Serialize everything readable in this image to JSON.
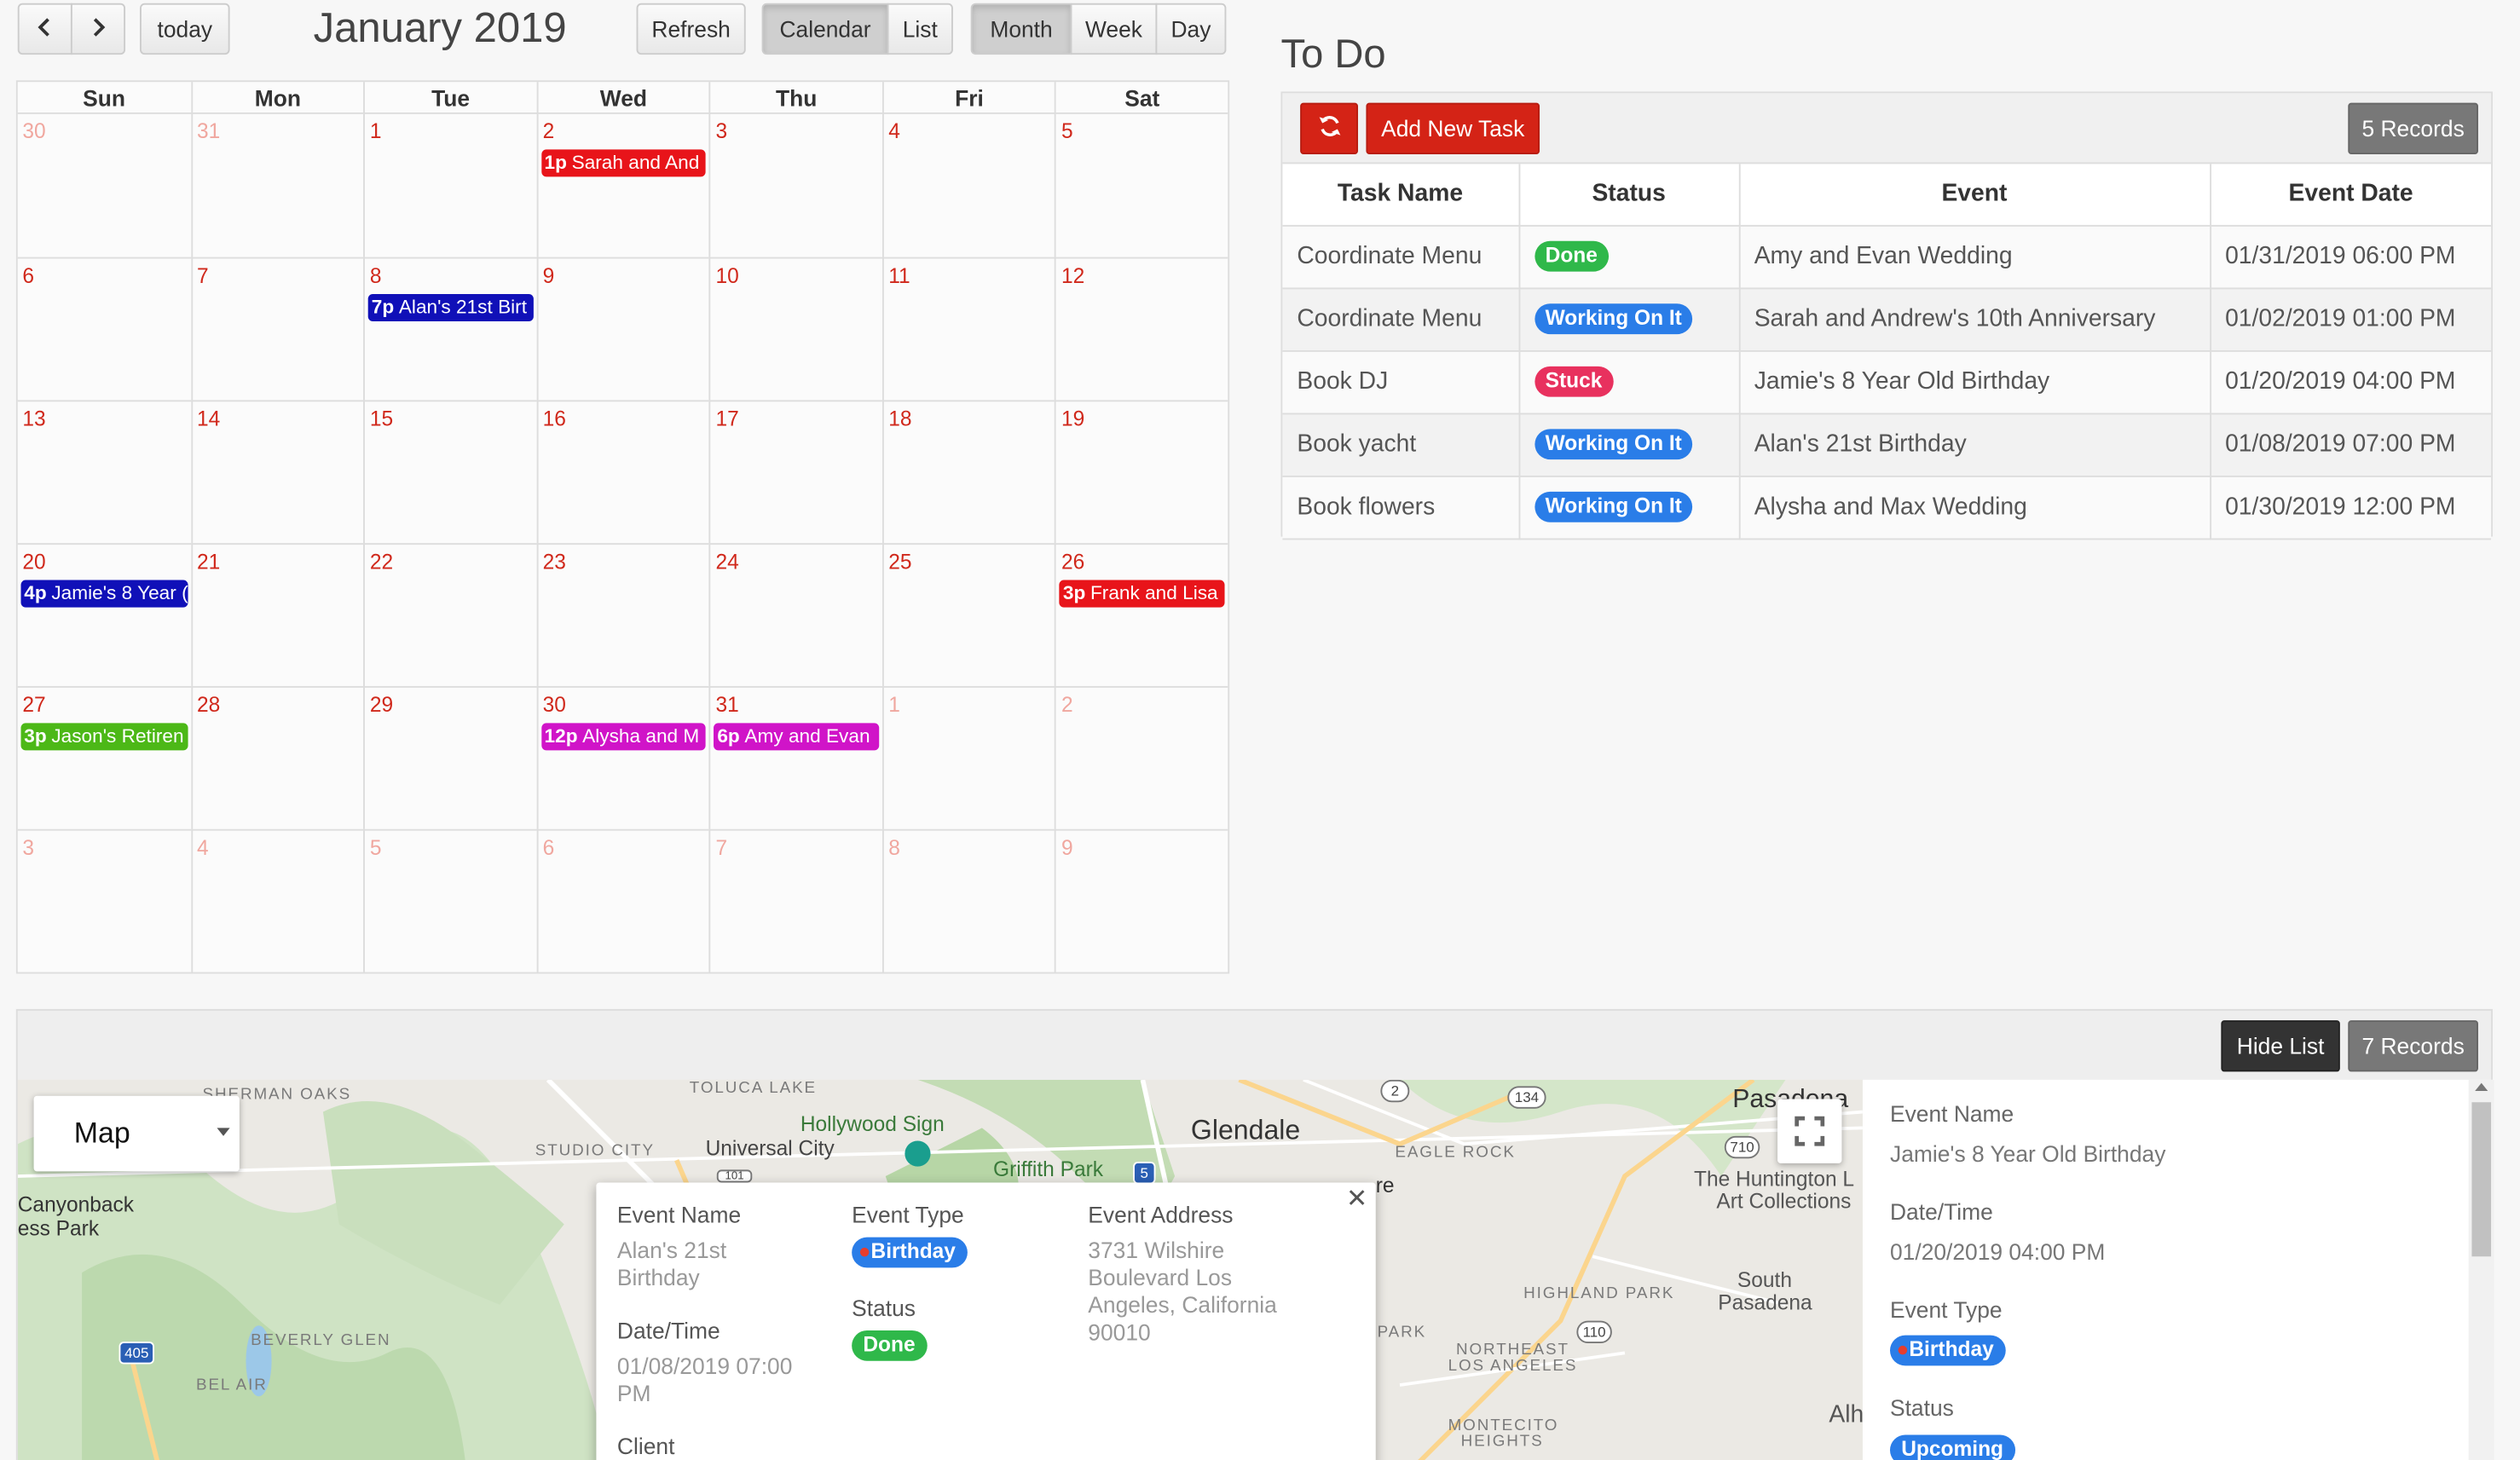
{
  "toolbar": {
    "prev_icon": "chevron-left-icon",
    "next_icon": "chevron-right-icon",
    "today": "today",
    "title": "January 2019",
    "refresh": "Refresh",
    "calendar": "Calendar",
    "list": "List",
    "month": "Month",
    "week": "Week",
    "day": "Day"
  },
  "calendar": {
    "weekdays": [
      "Sun",
      "Mon",
      "Tue",
      "Wed",
      "Thu",
      "Fri",
      "Sat"
    ],
    "days": [
      "30",
      "31",
      "1",
      "2",
      "3",
      "4",
      "5",
      "6",
      "7",
      "8",
      "9",
      "10",
      "11",
      "12",
      "13",
      "14",
      "15",
      "16",
      "17",
      "18",
      "19",
      "20",
      "21",
      "22",
      "23",
      "24",
      "25",
      "26",
      "27",
      "28",
      "29",
      "30",
      "31",
      "1",
      "2",
      "3",
      "4",
      "5",
      "6",
      "7",
      "8",
      "9"
    ],
    "events": [
      {
        "cell": 3,
        "time": "1p",
        "title": "Sarah and And",
        "color": "#e8141a"
      },
      {
        "cell": 9,
        "time": "7p",
        "title": "Alan's 21st Birt",
        "color": "#1010b8"
      },
      {
        "cell": 21,
        "time": "4p",
        "title": "Jamie's 8 Year (",
        "color": "#1010b8"
      },
      {
        "cell": 27,
        "time": "3p",
        "title": "Frank and Lisa",
        "color": "#e8141a"
      },
      {
        "cell": 28,
        "time": "3p",
        "title": "Jason's Retiren",
        "color": "#4cb817"
      },
      {
        "cell": 31,
        "time": "12p",
        "title": "Alysha and M",
        "color": "#d014c8"
      },
      {
        "cell": 32,
        "time": "6p",
        "title": "Amy and Evan",
        "color": "#d014c8"
      }
    ]
  },
  "todo": {
    "title": "To Do",
    "refresh_icon": "refresh-icon",
    "add_label": "Add New Task",
    "records": "5 Records",
    "columns": [
      "Task Name",
      "Status",
      "Event",
      "Event Date"
    ],
    "rows": [
      {
        "task": "Coordinate Menu",
        "status": "Done",
        "status_color": "#2fb84a",
        "event": "Amy and Evan Wedding",
        "date": "01/31/2019 06:00 PM"
      },
      {
        "task": "Coordinate Menu",
        "status": "Working On It",
        "status_color": "#2a7de8",
        "event": "Sarah and Andrew's 10th Anniversary",
        "date": "01/02/2019 01:00 PM"
      },
      {
        "task": "Book DJ",
        "status": "Stuck",
        "status_color": "#e8315e",
        "event": "Jamie's 8 Year Old Birthday",
        "date": "01/20/2019 04:00 PM"
      },
      {
        "task": "Book yacht",
        "status": "Working On It",
        "status_color": "#2a7de8",
        "event": "Alan's 21st Birthday",
        "date": "01/08/2019 07:00 PM"
      },
      {
        "task": "Book flowers",
        "status": "Working On It",
        "status_color": "#2a7de8",
        "event": "Alysha and Max Wedding",
        "date": "01/30/2019 12:00 PM"
      }
    ]
  },
  "mapsec": {
    "hide_list": "Hide List",
    "records": "7 Records",
    "map_type": "Map",
    "labels": {
      "sherman_oaks": "SHERMAN OAKS",
      "toluca_lake": "TOLUCA LAKE",
      "studio_city": "STUDIO CITY",
      "hollywood_sign": "Hollywood Sign",
      "universal_city": "Universal City",
      "griffith_park": "Griffith Park",
      "glendale": "Glendale",
      "eagle_rock": "EAGLE ROCK",
      "pasadena": "Pasadena",
      "huntington": "The Huntington L",
      "art_collections": "Art Collections",
      "canyonback": "Canyonback",
      "ess_park": "ess Park",
      "beverly_glen": "BEVERLY GLEN",
      "bel_air": "BEL AIR",
      "highland_park": "HIGHLAND PARK",
      "south_pasadena_1": "South",
      "south_pasadena_2": "Pasadena",
      "park": "PARK",
      "northeast_1": "NORTHEAST",
      "northeast_2": "LOS ANGELES",
      "montecito_1": "MONTECITO",
      "montecito_2": "HEIGHTS",
      "alh": "Alh",
      "re": "re",
      "r405": "405",
      "r134": "134",
      "r2": "2",
      "r710": "710",
      "r110": "110",
      "r5": "5",
      "r101": "101"
    },
    "popup": {
      "event_name_label": "Event Name",
      "event_name": "Alan's 21st Birthday",
      "event_type_label": "Event Type",
      "event_type": "Birthday",
      "event_address_label": "Event Address",
      "event_address": "3731 Wilshire Boulevard Los Angeles, California 90010",
      "datetime_label": "Date/Time",
      "datetime": "01/08/2019 07:00 PM",
      "status_label": "Status",
      "status": "Done",
      "client_label": "Client",
      "close_icon": "close-icon"
    },
    "side": {
      "event_name_label": "Event Name",
      "event_name": "Jamie's 8 Year Old Birthday",
      "datetime_label": "Date/Time",
      "datetime": "01/20/2019 04:00 PM",
      "event_type_label": "Event Type",
      "event_type": "Birthday",
      "status_label": "Status",
      "status": "Upcoming"
    }
  },
  "colors": {
    "red_button": "#d42316",
    "done": "#2fb84a",
    "working": "#2a7de8",
    "stuck": "#e8315e",
    "birthday": "#2a7de8",
    "upcoming": "#2a7de8"
  }
}
